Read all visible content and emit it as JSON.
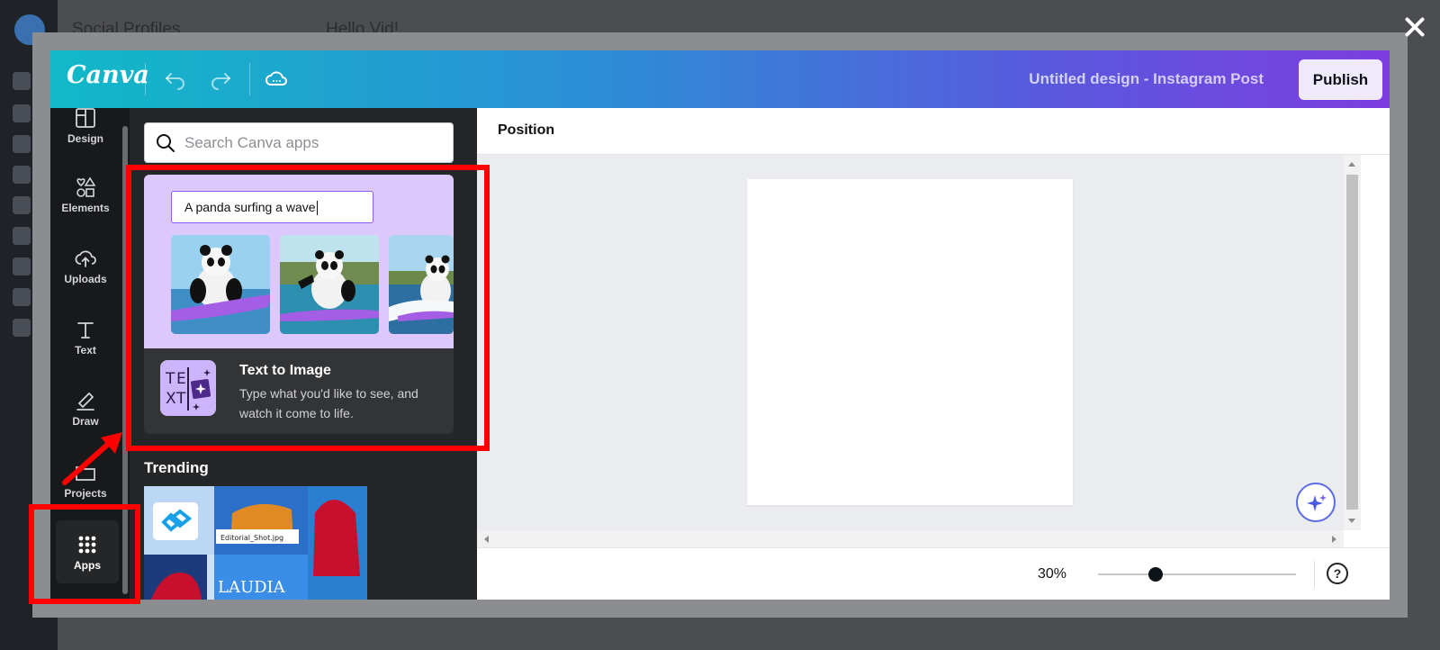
{
  "background_app": {
    "title": "Social Profiles",
    "subtitle": "Hello Vid!"
  },
  "editor_window": {
    "logo": "Canva",
    "doc_title": "Untitled design - Instagram Post",
    "publish_label": "Publish",
    "rail_items": [
      {
        "label": "Design",
        "icon": "layout-icon"
      },
      {
        "label": "Elements",
        "icon": "shapes-icon"
      },
      {
        "label": "Uploads",
        "icon": "cloud-upload-icon"
      },
      {
        "label": "Text",
        "icon": "text-icon"
      },
      {
        "label": "Draw",
        "icon": "pen-icon"
      },
      {
        "label": "Projects",
        "icon": "folder-icon"
      },
      {
        "label": "Apps",
        "icon": "grid-icon"
      }
    ],
    "search": {
      "placeholder": "Search Canva apps"
    },
    "featured_app": {
      "prompt_text": "A panda surfing a wave",
      "title": "Text to Image",
      "description": "Type what you'd like to see, and watch it come to life.",
      "icon_letters": "TEXT"
    },
    "trending": {
      "heading": "Trending",
      "file_label": "Editorial_Shot.jpg",
      "brand_text": "LAUDIA"
    },
    "toolbar": {
      "position_label": "Position"
    },
    "zoom": {
      "value": "30%",
      "level": 0.3
    },
    "help_label": "?"
  },
  "annotation_color": "#ff0000",
  "accent_colors": {
    "top_start": "#11b9c8",
    "top_end": "#7d3de0",
    "panel": "#252627",
    "hero": "#dcc8fb"
  }
}
